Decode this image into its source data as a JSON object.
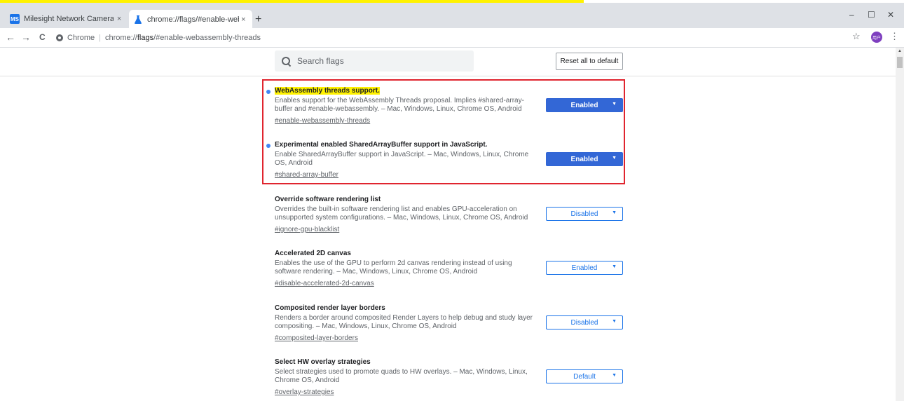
{
  "tabs": [
    {
      "favicon": "MS",
      "title": "Milesight Network Camera",
      "close": "×"
    },
    {
      "favicon": "flask-icon",
      "title": "chrome://flags/#enable-webasse",
      "close": "×"
    }
  ],
  "new_tab": "+",
  "window": {
    "minimize": "–",
    "maximize": "☐",
    "close": "✕"
  },
  "toolbar": {
    "back": "←",
    "forward": "→",
    "reload": "C",
    "star": "☆",
    "avatar": "用户",
    "menu": "⋮"
  },
  "omnibox": {
    "label": "Chrome",
    "separator": "|",
    "url_prefix": "chrome://",
    "url_bold": "flags",
    "url_suffix": "/#enable-webassembly-threads"
  },
  "header": {
    "search_placeholder": "Search flags",
    "reset_label": "Reset all to default"
  },
  "experiments": [
    {
      "title": "WebAssembly threads support.",
      "highlighted": true,
      "dot": true,
      "description": "Enables support for the WebAssembly Threads proposal. Implies #shared-array-buffer and #enable-webassembly. – Mac, Windows, Linux, Chrome OS, Android",
      "link": "#enable-webassembly-threads",
      "value": "Enabled"
    },
    {
      "title": "Experimental enabled SharedArrayBuffer support in JavaScript.",
      "highlighted": false,
      "dot": true,
      "description": "Enable SharedArrayBuffer support in JavaScript. – Mac, Windows, Linux, Chrome OS, Android",
      "link": "#shared-array-buffer",
      "value": "Enabled"
    },
    {
      "title": "Override software rendering list",
      "description": "Overrides the built-in software rendering list and enables GPU-acceleration on unsupported system configurations. – Mac, Windows, Linux, Chrome OS, Android",
      "link": "#ignore-gpu-blacklist",
      "value": "Disabled"
    },
    {
      "title": "Accelerated 2D canvas",
      "description": "Enables the use of the GPU to perform 2d canvas rendering instead of using software rendering. – Mac, Windows, Linux, Chrome OS, Android",
      "link": "#disable-accelerated-2d-canvas",
      "value": "Enabled"
    },
    {
      "title": "Composited render layer borders",
      "description": "Renders a border around composited Render Layers to help debug and study layer compositing. – Mac, Windows, Linux, Chrome OS, Android",
      "link": "#composited-layer-borders",
      "value": "Disabled"
    },
    {
      "title": "Select HW overlay strategies",
      "description": "Select strategies used to promote quads to HW overlays. – Mac, Windows, Linux, Chrome OS, Android",
      "link": "#overlay-strategies",
      "value": "Default"
    }
  ],
  "dropdown_arrow": "▼",
  "colors": {
    "accent": "#3367d6",
    "highlight": "#fff200",
    "annotation": "#e0252f"
  }
}
